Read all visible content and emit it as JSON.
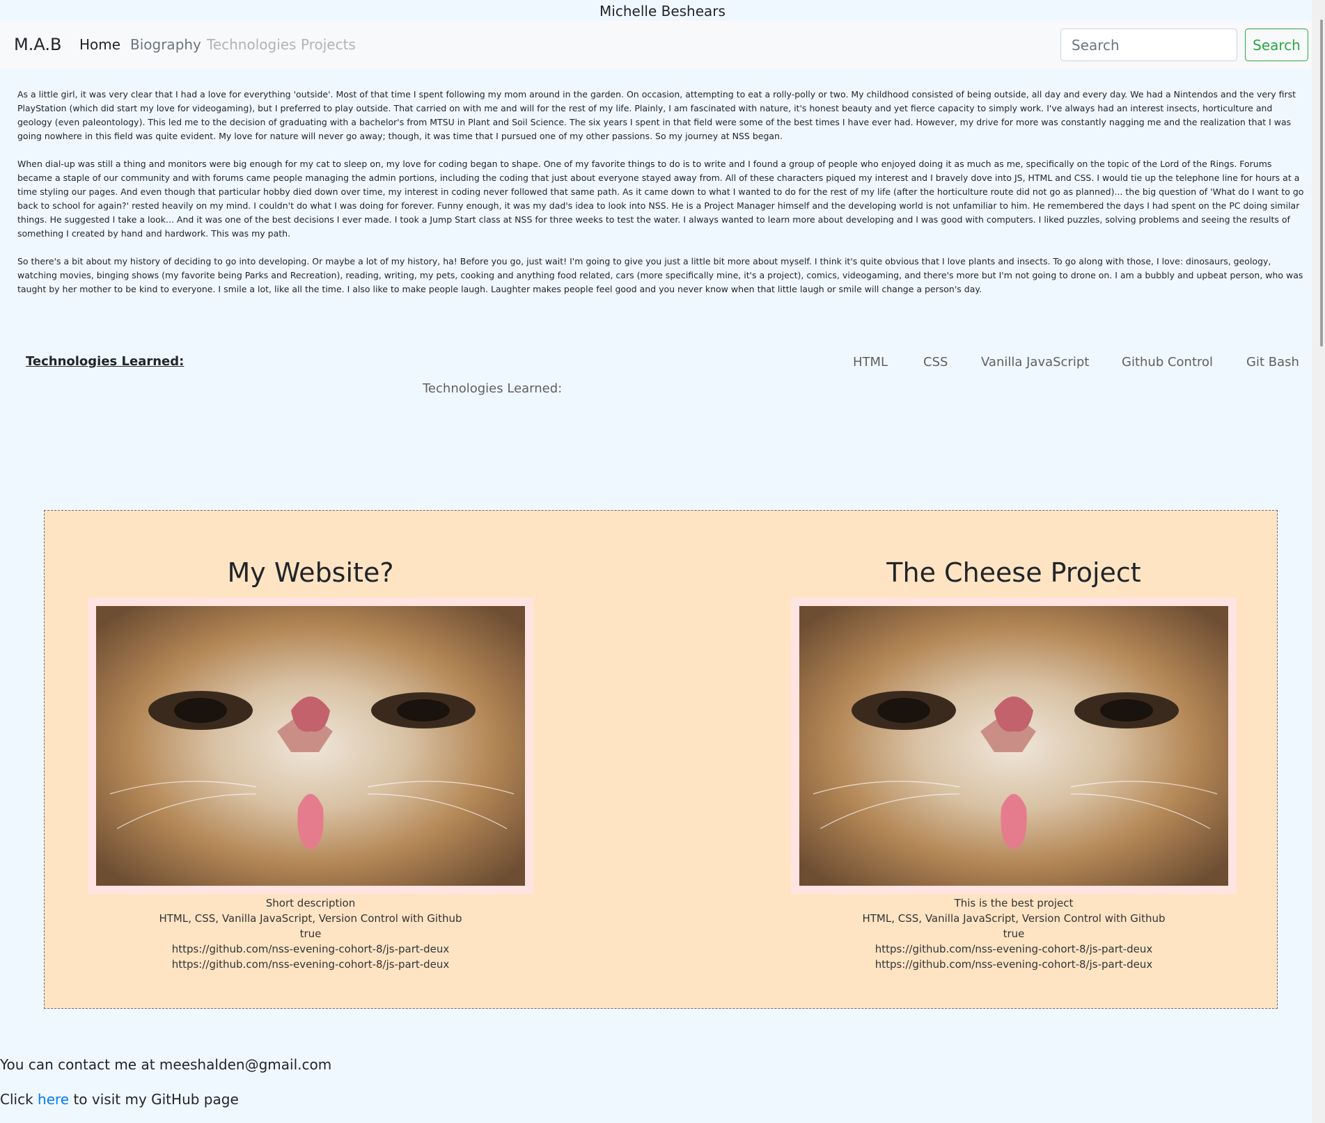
{
  "site": {
    "title": "Michelle Beshears"
  },
  "nav": {
    "brand": "M.A.B",
    "items": [
      "Home",
      "Biography",
      "Technologies",
      "Projects"
    ],
    "search_placeholder": "Search",
    "search_button": "Search"
  },
  "bio": {
    "paragraphs": [
      "As a little girl, it was very clear that I had a love for everything 'outside'. Most of that time I spent following my mom around in the garden. On occasion, attempting to eat a rolly-polly or two. My childhood consisted of being outside, all day and every day. We had a Nintendos and the very first PlayStation (which did start my love for videogaming), but I preferred to play outside. That carried on with me and will for the rest of my life. Plainly, I am fascinated with nature, it's honest beauty and yet fierce capacity to simply work. I've always had an interest insects, horticulture and geology (even paleontology). This led me to the decision of graduating with a bachelor's from MTSU in Plant and Soil Science. The six years I spent in that field were some of the best times I have ever had. However, my drive for more was constantly nagging me and the realization that I was going nowhere in this field was quite evident. My love for nature will never go away; though, it was time that I pursued one of my other passions. So my journey at NSS began.",
      "When dial-up was still a thing and monitors were big enough for my cat to sleep on, my love for coding began to shape. One of my favorite things to do is to write and I found a group of people who enjoyed doing it as much as me, specifically on the topic of the Lord of the Rings. Forums became a staple of our community and with forums came people managing the admin portions, including the coding that just about everyone stayed away from. All of these characters piqued my interest and I bravely dove into JS, HTML and CSS. I would tie up the telephone line for hours at a time styling our pages. And even though that particular hobby died down over time, my interest in coding never followed that same path. As it came down to what I wanted to do for the rest of my life (after the horticulture route did not go as planned)... the big question of 'What do I want to go back to school for again?' rested heavily on my mind. I couldn't do what I was doing for forever. Funny enough, it was my dad's idea to look into NSS. He is a Project Manager himself and the developing world is not unfamiliar to him. He remembered the days I had spent on the PC doing similar things. He suggested I take a look... And it was one of the best decisions I ever made. I took a Jump Start class at NSS for three weeks to test the water. I always wanted to learn more about developing and I was good with computers. I liked puzzles, solving problems and seeing the results of something I created by hand and hardwork. This was my path.",
      "So there's a bit about my history of deciding to go into developing. Or maybe a lot of my history, ha! Before you go, just wait! I'm going to give you just a little bit more about myself. I think it's quite obvious that I love plants and insects. To go along with those, I love: dinosaurs, geology, watching movies, binging shows (my favorite being Parks and Recreation), reading, writing, my pets, cooking and anything food related, cars (more specifically mine, it's a project), comics, videogaming, and there's more but I'm not going to drone on. I am a bubbly and upbeat person, who was taught by her mother to be kind to everyone. I smile a lot, like all the time. I also like to make people laugh. Laughter makes people feel good and you never know when that little laugh or smile will change a person's day."
    ]
  },
  "technologies": {
    "heading": "Technologies Learned:",
    "items": [
      "HTML",
      "CSS",
      "Vanilla JavaScript",
      "Github Control",
      "Git Bash"
    ],
    "subheading": "Technologies Learned:"
  },
  "projects": [
    {
      "title": "My Website?",
      "image_icon": "cat-photo",
      "description": "Short description",
      "tech": "HTML, CSS, Vanilla JavaScript, Version Control with Github",
      "flag": "true",
      "link1": "https://github.com/nss-evening-cohort-8/js-part-deux",
      "link2": "https://github.com/nss-evening-cohort-8/js-part-deux"
    },
    {
      "title": "The Cheese Project",
      "image_icon": "cat-photo",
      "description": "This is the best project",
      "tech": "HTML, CSS, Vanilla JavaScript, Version Control with Github",
      "flag": "true",
      "link1": "https://github.com/nss-evening-cohort-8/js-part-deux",
      "link2": "https://github.com/nss-evening-cohort-8/js-part-deux"
    }
  ],
  "footer": {
    "contact": "You can contact me at meeshalden@gmail.com",
    "github_prefix": "Click ",
    "github_link": "here",
    "github_suffix": " to visit my GitHub page"
  },
  "colors": {
    "page_bg": "#f0f8ff",
    "project_bg": "#ffe4c4",
    "frame_bg": "#ffe4e1",
    "search_green": "#28a745",
    "link_blue": "#007bff"
  }
}
